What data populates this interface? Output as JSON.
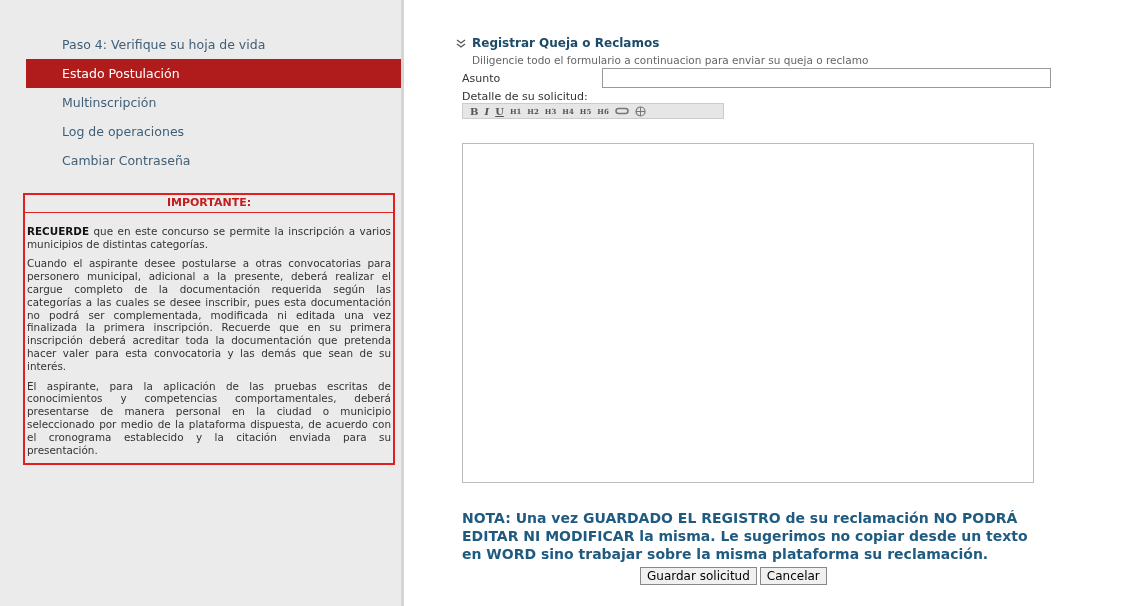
{
  "sidebar": {
    "items": [
      {
        "label": "Paso 4: Verifique su hoja de vida",
        "selected": false
      },
      {
        "label": "Estado Postulación",
        "selected": true
      },
      {
        "label": "Multinscripción",
        "selected": false
      },
      {
        "label": "Log de operaciones",
        "selected": false
      },
      {
        "label": "Cambiar Contraseña",
        "selected": false
      }
    ],
    "notice": {
      "title": "IMPORTANTE:",
      "paragraphs": [
        "**RECUERDE** que en este concurso se permite la inscripción a varios municipios de distintas categorías.",
        "Cuando el aspirante desee postularse a otras convocatorias para personero municipal, adicional a la presente, deberá realizar el cargue completo de la documentación requerida según las categorías a las cuales se desee inscribir, pues esta documentación no podrá ser complementada, modificada ni editada una vez finalizada la primera inscripción. Recuerde que en su primera inscripción deberá acreditar toda la documentación que pretenda hacer valer para esta convocatoria y las demás que sean de su interés.",
        "El aspirante, para la aplicación de las pruebas escritas de conocimientos y competencias comportamentales, deberá presentarse de manera personal en la ciudad o municipio seleccionado por medio de la plataforma dispuesta, de acuerdo con el cronograma establecido y la citación enviada para su presentación."
      ]
    }
  },
  "form": {
    "title": "Registrar Queja o Reclamos",
    "description": "Diligencie todo el formulario a continuacion para enviar su queja o reclamo",
    "subject_label": "Asunto",
    "detail_label": "Detalle de su solicitud:",
    "toolbar": [
      {
        "label": "B",
        "kind": "bold"
      },
      {
        "label": "I",
        "kind": "italic"
      },
      {
        "label": "U",
        "kind": "underline"
      },
      {
        "label": "H1",
        "kind": "heading"
      },
      {
        "label": "H2",
        "kind": "heading"
      },
      {
        "label": "H3",
        "kind": "heading"
      },
      {
        "label": "H4",
        "kind": "heading"
      },
      {
        "label": "H5",
        "kind": "heading"
      },
      {
        "label": "H6",
        "kind": "heading"
      },
      {
        "kind": "link"
      },
      {
        "kind": "unlink"
      }
    ],
    "note": "NOTA: Una vez GUARDADO EL REGISTRO de su reclamación NO PODRÁ EDITAR NI MODIFICAR la misma. Le sugerimos no copiar desde un texto en WORD sino trabajar sobre la misma plataforma su reclamación.",
    "buttons": [
      "Guardar solicitud",
      "Cancelar"
    ]
  }
}
